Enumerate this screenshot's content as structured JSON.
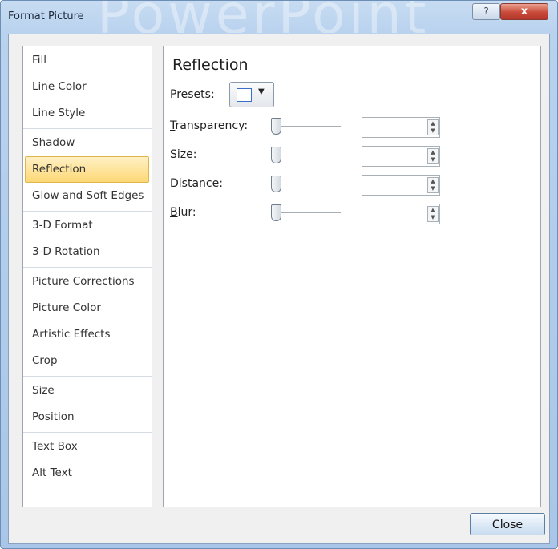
{
  "window": {
    "title": "Format Picture",
    "watermark": "PowerPoint",
    "help_button": "?",
    "close_x_button": "x"
  },
  "sidebar": {
    "groups": [
      [
        "Fill",
        "Line Color",
        "Line Style"
      ],
      [
        "Shadow",
        "Reflection",
        "Glow and Soft Edges"
      ],
      [
        "3-D Format",
        "3-D Rotation"
      ],
      [
        "Picture Corrections",
        "Picture Color",
        "Artistic Effects",
        "Crop"
      ],
      [
        "Size",
        "Position"
      ],
      [
        "Text Box",
        "Alt Text"
      ]
    ],
    "selected": "Reflection"
  },
  "panel": {
    "title": "Reflection",
    "presets_label": "Presets:",
    "rows": [
      {
        "label": "Transparency:",
        "value": ""
      },
      {
        "label": "Size:",
        "value": ""
      },
      {
        "label": "Distance:",
        "value": ""
      },
      {
        "label": "Blur:",
        "value": ""
      }
    ]
  },
  "footer": {
    "close_label": "Close"
  },
  "colors": {
    "selected_item": "#fdd875",
    "close_x": "#c94a3a"
  }
}
